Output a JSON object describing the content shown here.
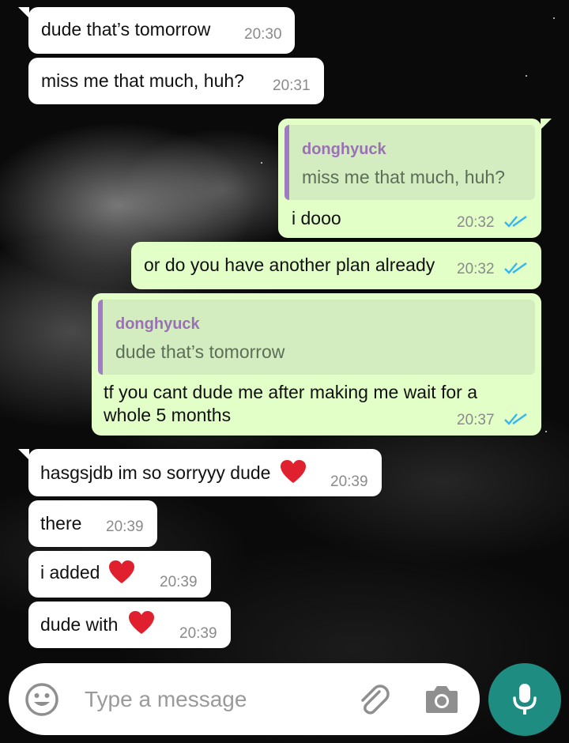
{
  "messages": [
    {
      "text": "dude that’s tomorrow",
      "time": "20:30"
    },
    {
      "text": "miss me that much, huh?",
      "time": "20:31"
    },
    {
      "quote_author": "donghyuck",
      "quote_text": "miss me that much, huh?",
      "text": "i dooo",
      "time": "20:32",
      "status": "read"
    },
    {
      "text": "or do you have another plan already",
      "time": "20:32",
      "status": "read"
    },
    {
      "quote_author": "donghyuck",
      "quote_text": "dude that’s tomorrow",
      "text_line1": "tf you cant dude me after making me wait for a",
      "text_line2": "whole 5 months",
      "time": "20:37",
      "status": "read"
    },
    {
      "text": "hasgsjdb im so sorryyy dude",
      "emoji": "red-heart",
      "time": "20:39"
    },
    {
      "text": "there",
      "time": "20:39"
    },
    {
      "text": "i added",
      "emoji": "red-heart",
      "time": "20:39"
    },
    {
      "text": "dude with",
      "emoji": "red-heart",
      "time": "20:39"
    }
  ],
  "composer": {
    "placeholder": "Type a message",
    "emoji_icon": "smiley-icon",
    "attach_icon": "paperclip-icon",
    "camera_icon": "camera-icon",
    "mic_icon": "microphone-icon"
  },
  "colors": {
    "incoming_bubble": "#ffffff",
    "outgoing_bubble": "#e1ffc7",
    "read_ticks": "#34b7f1",
    "quote_bar": "#a07cc0",
    "mic_button": "#1f8c82"
  }
}
